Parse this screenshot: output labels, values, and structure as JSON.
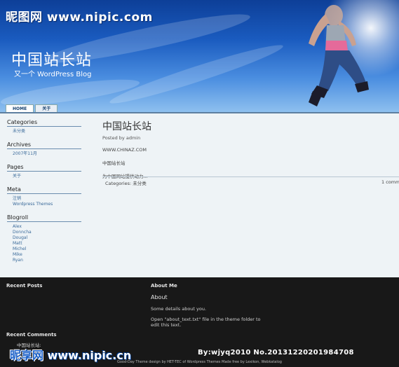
{
  "watermark_top": "昵图网 www.nipic.com",
  "header": {
    "site_title": "中国站长站",
    "site_description": "又一个 WordPress Blog"
  },
  "tabs": [
    {
      "label": "HOME",
      "active": true
    },
    {
      "label": "关于",
      "active": false
    }
  ],
  "sidebar": {
    "categories": {
      "title": "Categories",
      "items": [
        "未分类"
      ]
    },
    "archives": {
      "title": "Archives",
      "items": [
        "2007年11月"
      ]
    },
    "pages": {
      "title": "Pages",
      "items": [
        "关于"
      ]
    },
    "meta": {
      "title": "Meta",
      "items": [
        "注销",
        "Wordpress Themes"
      ]
    },
    "blogroll": {
      "title": "Blogroll",
      "items": [
        "Alex",
        "Donncha",
        "Dougal",
        "Matt",
        "Michel",
        "Mike",
        "Ryan"
      ]
    }
  },
  "post": {
    "title": "中国站长站",
    "meta": "Posted by admin",
    "lines": [
      "WWW.CHINAZ.COM",
      "中国站长站",
      "为中国网站提供动力..."
    ],
    "categories": "Categories: 未分类",
    "comments": "1 comm"
  },
  "footer": {
    "recent_posts_title": "Recent Posts",
    "about_me_title": "About Me",
    "about_heading": "About",
    "about_text1": "Some details about you.",
    "about_text2": "Open \"about_text.txt\" file in the theme folder to edit this text.",
    "recent_comments_title": "Recent Comments",
    "recent_comment": "中国站长站:",
    "credit": "Good-Day Theme design by HET-TEC of Wordpress Themes Made free by Lexikon, Webkatalog"
  },
  "watermark_bottom": {
    "brand": "昵享网",
    "url": "www.nipic.cn"
  },
  "watermark_id": "By:wjyq2010  No.20131220201984708",
  "colors": {
    "header_blue": "#1a5bbf",
    "content_bg": "#eef3f6",
    "footer_bg": "#181818",
    "link": "#3a6a9a"
  }
}
